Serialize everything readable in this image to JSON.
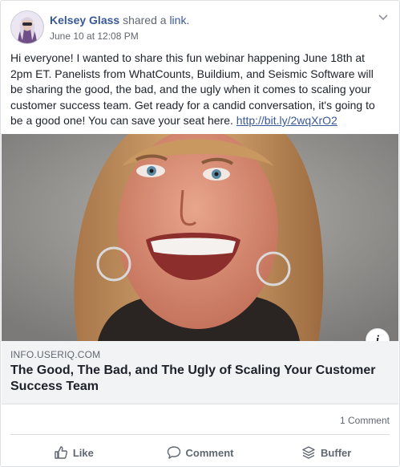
{
  "post": {
    "author": "Kelsey Glass",
    "action_text": "shared a",
    "action_link": "link.",
    "timestamp": "June 10 at 12:08 PM",
    "body": "Hi everyone! I wanted to share this fun webinar happening June 18th at 2pm ET. Panelists from WhatCounts, Buildium, and Seismic Software will be sharing the good, the bad, and the ugly when it comes to scaling your customer success team. Get ready for a candid conversation, it's going to be a good one! You can save your seat here. ",
    "body_link": "http://bit.ly/2wqXrO2"
  },
  "link_preview": {
    "domain": "INFO.USERIQ.COM",
    "title": "The Good, The Bad, and The Ugly of Scaling Your Customer Success Team",
    "info_glyph": "i"
  },
  "stats": {
    "comments": "1 Comment"
  },
  "actions": {
    "like": "Like",
    "comment": "Comment",
    "buffer": "Buffer"
  },
  "icons": {
    "options": "chevron-down-icon",
    "like": "thumbs-up-icon",
    "comment": "speech-bubble-icon",
    "buffer": "stack-icon",
    "info": "info-icon"
  },
  "colors": {
    "link": "#385898",
    "text": "#1d2129",
    "muted": "#606770",
    "preview_bg": "#f2f3f5"
  }
}
